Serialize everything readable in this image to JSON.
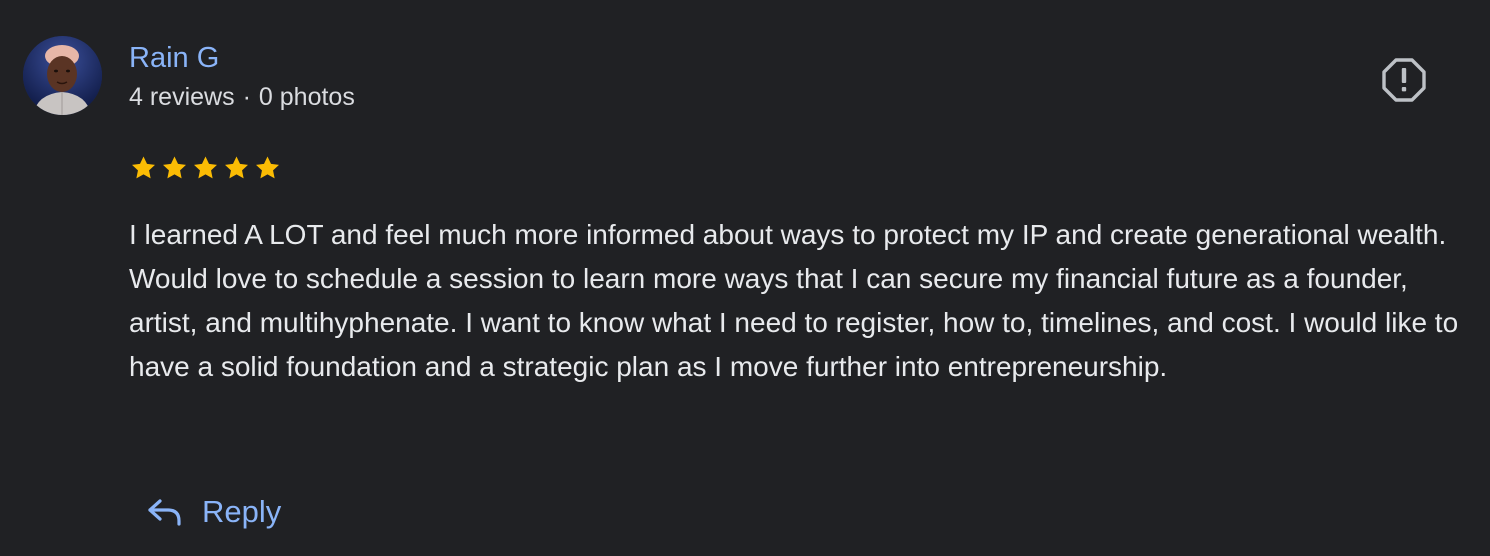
{
  "reviewer": {
    "name": "Rain G",
    "reviews_count": "4 reviews",
    "separator": "·",
    "photos_count": "0 photos",
    "avatar_icon": "user-photo"
  },
  "flag": {
    "icon": "report-octagon-icon"
  },
  "rating": {
    "stars": 5,
    "max": 5,
    "color": "#fbbc04"
  },
  "review": {
    "text": "I learned A LOT and feel much more informed about ways to protect my IP and create generational wealth. Would love to schedule a session to learn more ways that I can secure my financial future as a founder, artist, and multihyphenate. I want to know what I need to register, how to, timelines, and cost. I would like to have a solid foundation and a strategic plan as I move further into entrepreneurship."
  },
  "reply": {
    "label": "Reply",
    "icon": "reply-arrow-icon"
  },
  "colors": {
    "background": "#202124",
    "link": "#8ab4f8",
    "text": "#e8eaed",
    "muted": "#dadce0"
  }
}
